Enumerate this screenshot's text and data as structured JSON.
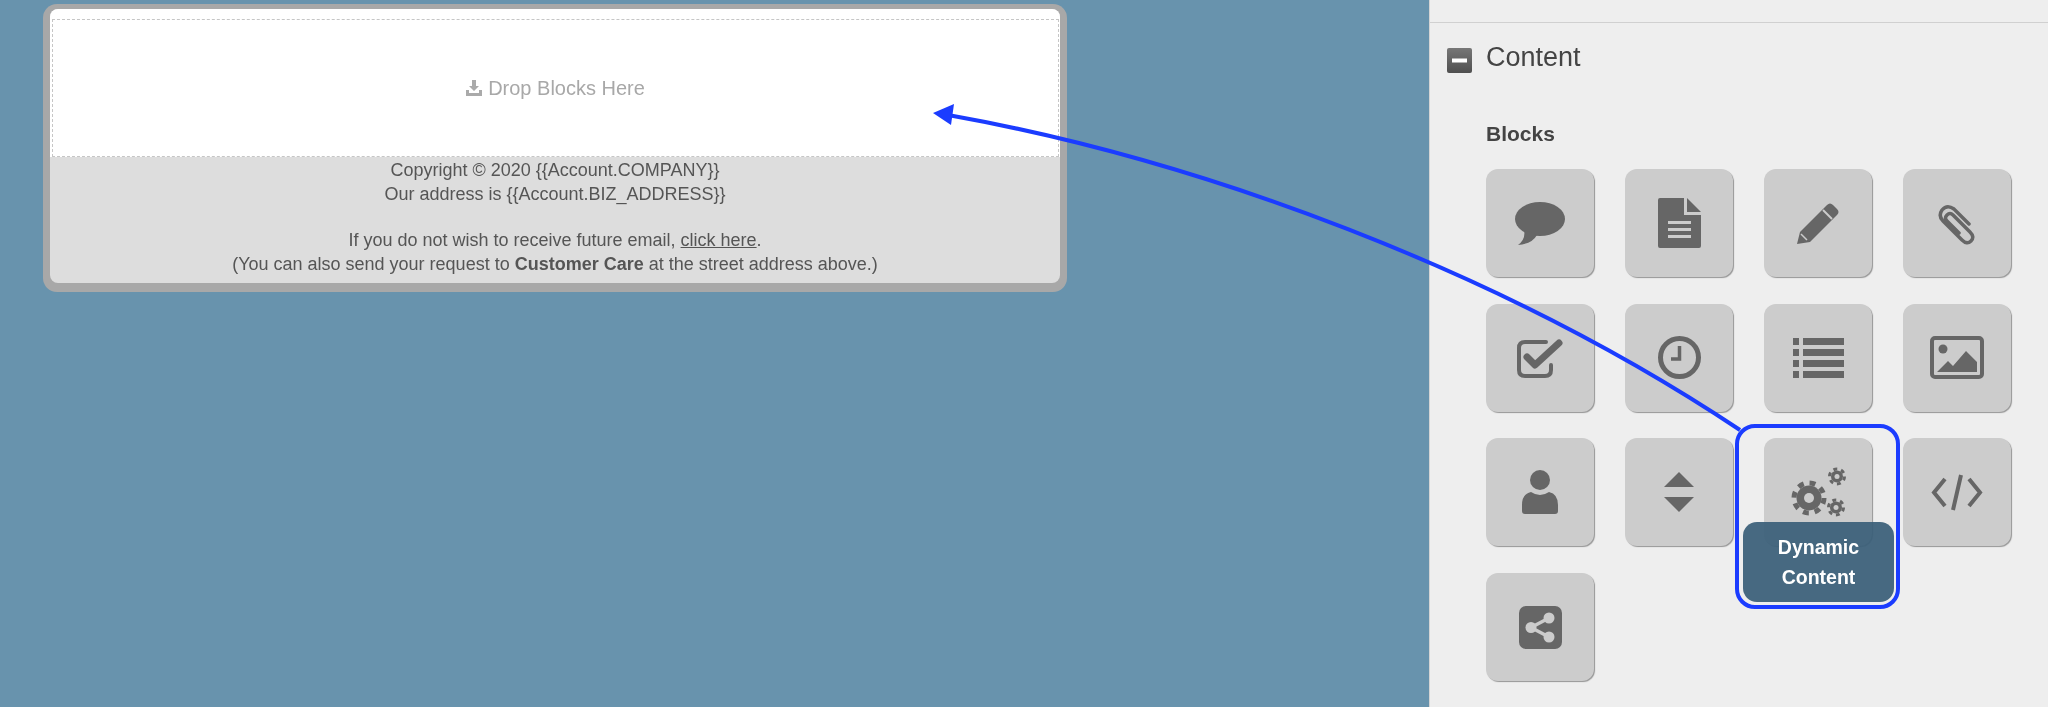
{
  "email": {
    "drop_zone": {
      "label": "Drop Blocks Here"
    },
    "footer": {
      "copyright": "Copyright © 2020 {{Account.COMPANY}}",
      "address": "Our address is {{Account.BIZ_ADDRESS}}",
      "unsubscribe": {
        "text": "If you do not wish to receive future email, ",
        "link": "click here",
        "after": "."
      },
      "note": "(You can also send your request to **Customer Care** at the street address above.)"
    }
  },
  "panel": {
    "section": {
      "title": "Content",
      "expanded": true
    },
    "group_label": "Blocks",
    "blocks": [
      {
        "kind": "comment",
        "highlighted": false
      },
      {
        "kind": "document",
        "highlighted": false
      },
      {
        "kind": "pencil",
        "highlighted": false
      },
      {
        "kind": "paperclip",
        "highlighted": false
      },
      {
        "kind": "checkbox",
        "highlighted": false
      },
      {
        "kind": "clock",
        "highlighted": false
      },
      {
        "kind": "list",
        "highlighted": false
      },
      {
        "kind": "image",
        "highlighted": false
      },
      {
        "kind": "user",
        "highlighted": false
      },
      {
        "kind": "sort",
        "highlighted": false
      },
      {
        "kind": "gears",
        "highlighted": true,
        "tooltip": "Dynamic Content"
      },
      {
        "kind": "code",
        "highlighted": false
      },
      {
        "kind": "share",
        "highlighted": false
      }
    ]
  }
}
